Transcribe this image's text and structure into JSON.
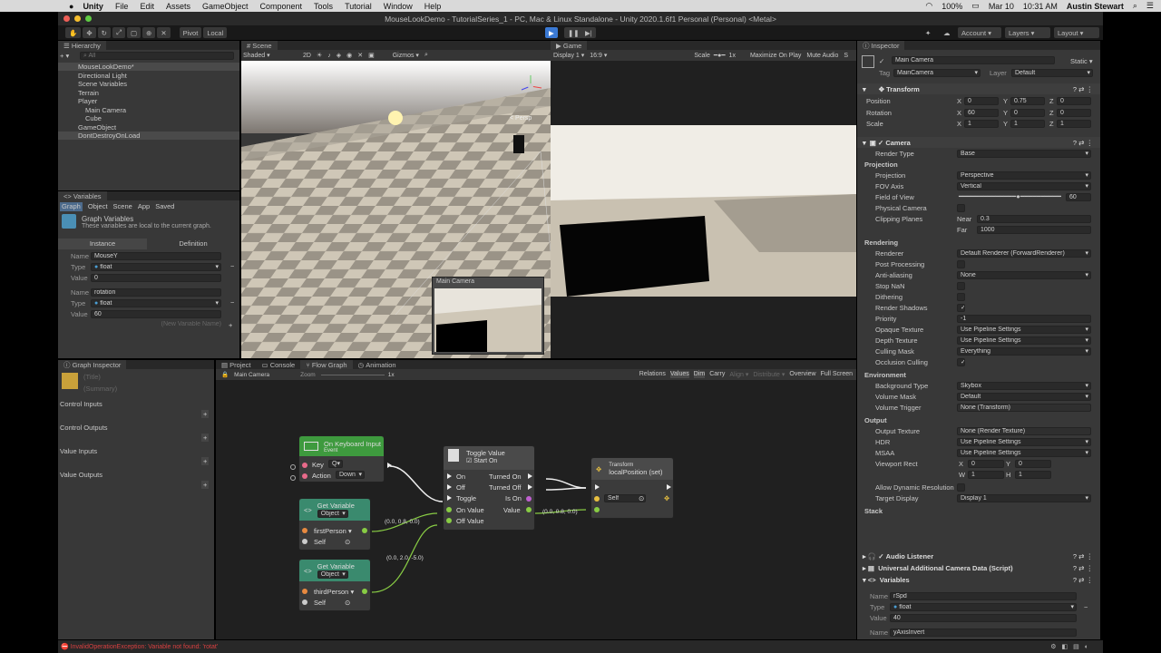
{
  "menubar": {
    "apple": "",
    "app": "Unity",
    "items": [
      "File",
      "Edit",
      "Assets",
      "GameObject",
      "Component",
      "Tools",
      "Tutorial",
      "Window",
      "Help"
    ],
    "battery": "100%",
    "date": "Mar 10",
    "time": "10:31 AM",
    "user": "Austin Stewart"
  },
  "window": {
    "title": "MouseLookDemo - TutorialSeries_1 - PC, Mac & Linux Standalone - Unity 2020.1.6f1 Personal (Personal) <Metal>"
  },
  "toolbar": {
    "pivot": "Pivot",
    "local": "Local",
    "account": "Account",
    "layers": "Layers",
    "layout": "Layout"
  },
  "hierarchy": {
    "tab": "Hierarchy",
    "search": "All",
    "items": [
      {
        "label": "MouseLookDemo*",
        "indent": 0
      },
      {
        "label": "Directional Light",
        "indent": 2
      },
      {
        "label": "Scene Variables",
        "indent": 2
      },
      {
        "label": "Terrain",
        "indent": 2
      },
      {
        "label": "Player",
        "indent": 2
      },
      {
        "label": "Main Camera",
        "indent": 3
      },
      {
        "label": "Cube",
        "indent": 3
      },
      {
        "label": "GameObject",
        "indent": 2
      },
      {
        "label": "DontDestroyOnLoad",
        "indent": 1
      }
    ]
  },
  "variables": {
    "tab": "Variables",
    "scopes": [
      "Graph",
      "Object",
      "Scene",
      "App",
      "Saved"
    ],
    "title": "Graph Variables",
    "desc": "These variables are local to the current graph.",
    "col1": "Instance",
    "col2": "Definition",
    "vars": [
      {
        "name": "MouseY",
        "type": "float",
        "value": "0"
      },
      {
        "name": "rotation",
        "type": "float",
        "value": "60"
      }
    ],
    "new_placeholder": "(New Variable Name)",
    "name_label": "Name",
    "type_label": "Type",
    "value_label": "Value"
  },
  "scene": {
    "tab": "Scene",
    "shading": "Shaded",
    "mode2d": "2D",
    "gizmos": "Gizmos",
    "persp": "< Persp",
    "preview_title": "Main Camera"
  },
  "game": {
    "tab": "Game",
    "display": "Display 1",
    "aspect": "16:9",
    "scale_label": "Scale",
    "scale_val": "1x",
    "max": "Maximize On Play",
    "mute": "Mute Audio",
    "stats": "S"
  },
  "graph_inspector": {
    "tab": "Graph Inspector",
    "title_ph": "(Title)",
    "summary_ph": "(Summary)",
    "sections": [
      "Control Inputs",
      "Control Outputs",
      "Value Inputs",
      "Value Outputs"
    ]
  },
  "bottom_tabs": [
    "Project",
    "Console",
    "Flow Graph",
    "Animation"
  ],
  "flow": {
    "breadcrumb": "Main Camera",
    "zoom_label": "Zoom",
    "zoom_val": "1x",
    "tools": [
      "Relations",
      "Values",
      "Dim",
      "Carry",
      "Align ▾",
      "Distribute ▾",
      "Overview",
      "Full Screen"
    ],
    "nodes": {
      "keyboard": {
        "title": "On Keyboard Input",
        "sub": "Event",
        "key_label": "Key",
        "key_val": "Q",
        "action_label": "Action",
        "action_val": "Down"
      },
      "getvar1": {
        "title": "Get Variable",
        "kind": "Object",
        "var": "firstPerson",
        "self": "Self"
      },
      "getvar2": {
        "title": "Get Variable",
        "kind": "Object",
        "var": "thirdPerson",
        "self": "Self"
      },
      "toggle": {
        "title": "Toggle Value",
        "start": "Start On",
        "on": "On",
        "off": "Off",
        "toggle": "Toggle",
        "onval": "On Value",
        "offval": "Off Value",
        "turned_on": "Turned On",
        "turned_off": "Turned Off",
        "is_on": "Is On",
        "value": "Value"
      },
      "transform": {
        "title": "Transform",
        "sub": "localPosition (set)",
        "self": "Self"
      }
    },
    "labels": {
      "v1": "(0.0, 0.8, 0.0)",
      "v2": "(0.0, 2.0, -5.0)",
      "v3": "(0.0, 0.8, 0.0)"
    }
  },
  "inspector": {
    "tab": "Inspector",
    "object": "Main Camera",
    "static": "Static",
    "tag_label": "Tag",
    "tag": "MainCamera",
    "layer_label": "Layer",
    "layer": "Default",
    "transform": {
      "title": "Transform",
      "rows": [
        {
          "label": "Position",
          "x": "0",
          "y": "0.75",
          "z": "0"
        },
        {
          "label": "Rotation",
          "x": "60",
          "y": "0",
          "z": "0"
        },
        {
          "label": "Scale",
          "x": "1",
          "y": "1",
          "z": "1"
        }
      ]
    },
    "camera": {
      "title": "Camera",
      "render_type_label": "Render Type",
      "render_type": "Base",
      "projection_head": "Projection",
      "projection_label": "Projection",
      "projection": "Perspective",
      "fov_axis_label": "FOV Axis",
      "fov_axis": "Vertical",
      "fov_label": "Field of View",
      "fov": "60",
      "physical": "Physical Camera",
      "clip_label": "Clipping Planes",
      "near_label": "Near",
      "near": "0.3",
      "far_label": "Far",
      "far": "1000",
      "rendering_head": "Rendering",
      "renderer_label": "Renderer",
      "renderer": "Default Renderer (ForwardRenderer)",
      "post": "Post Processing",
      "aa_label": "Anti-aliasing",
      "aa": "None",
      "stopnan": "Stop NaN",
      "dither": "Dithering",
      "shadows": "Render Shadows",
      "priority_label": "Priority",
      "priority": "-1",
      "opaque_label": "Opaque Texture",
      "opaque": "Use Pipeline Settings",
      "depth_label": "Depth Texture",
      "depth": "Use Pipeline Settings",
      "culling_label": "Culling Mask",
      "culling": "Everything",
      "occlusion": "Occlusion Culling",
      "env_head": "Environment",
      "bg_label": "Background Type",
      "bg": "Skybox",
      "vmask_label": "Volume Mask",
      "vmask": "Default",
      "vtrig_label": "Volume Trigger",
      "vtrig": "None (Transform)",
      "output_head": "Output",
      "outtex_label": "Output Texture",
      "outtex": "None (Render Texture)",
      "hdr_label": "HDR",
      "hdr": "Use Pipeline Settings",
      "msaa_label": "MSAA",
      "msaa": "Use Pipeline Settings",
      "vp_label": "Viewport Rect",
      "vp_x": "0",
      "vp_y": "0",
      "vp_w": "1",
      "vp_h": "1",
      "dyn": "Allow Dynamic Resolution",
      "target_label": "Target Display",
      "target": "Display 1",
      "stack_head": "Stack"
    },
    "components": [
      "Audio Listener",
      "Universal Additional Camera Data (Script)",
      "Variables"
    ],
    "var": {
      "name_label": "Name",
      "name": "rSpd",
      "type_label": "Type",
      "type": "float",
      "value_label": "Value",
      "value": "40",
      "name2": "yAxisInvert"
    }
  },
  "status": {
    "error": "InvalidOperationException: Variable not found: 'rotat'"
  },
  "colors": {
    "accent": "#4a8fe7",
    "event_green": "#3e9a3e",
    "error": "#d84040"
  }
}
